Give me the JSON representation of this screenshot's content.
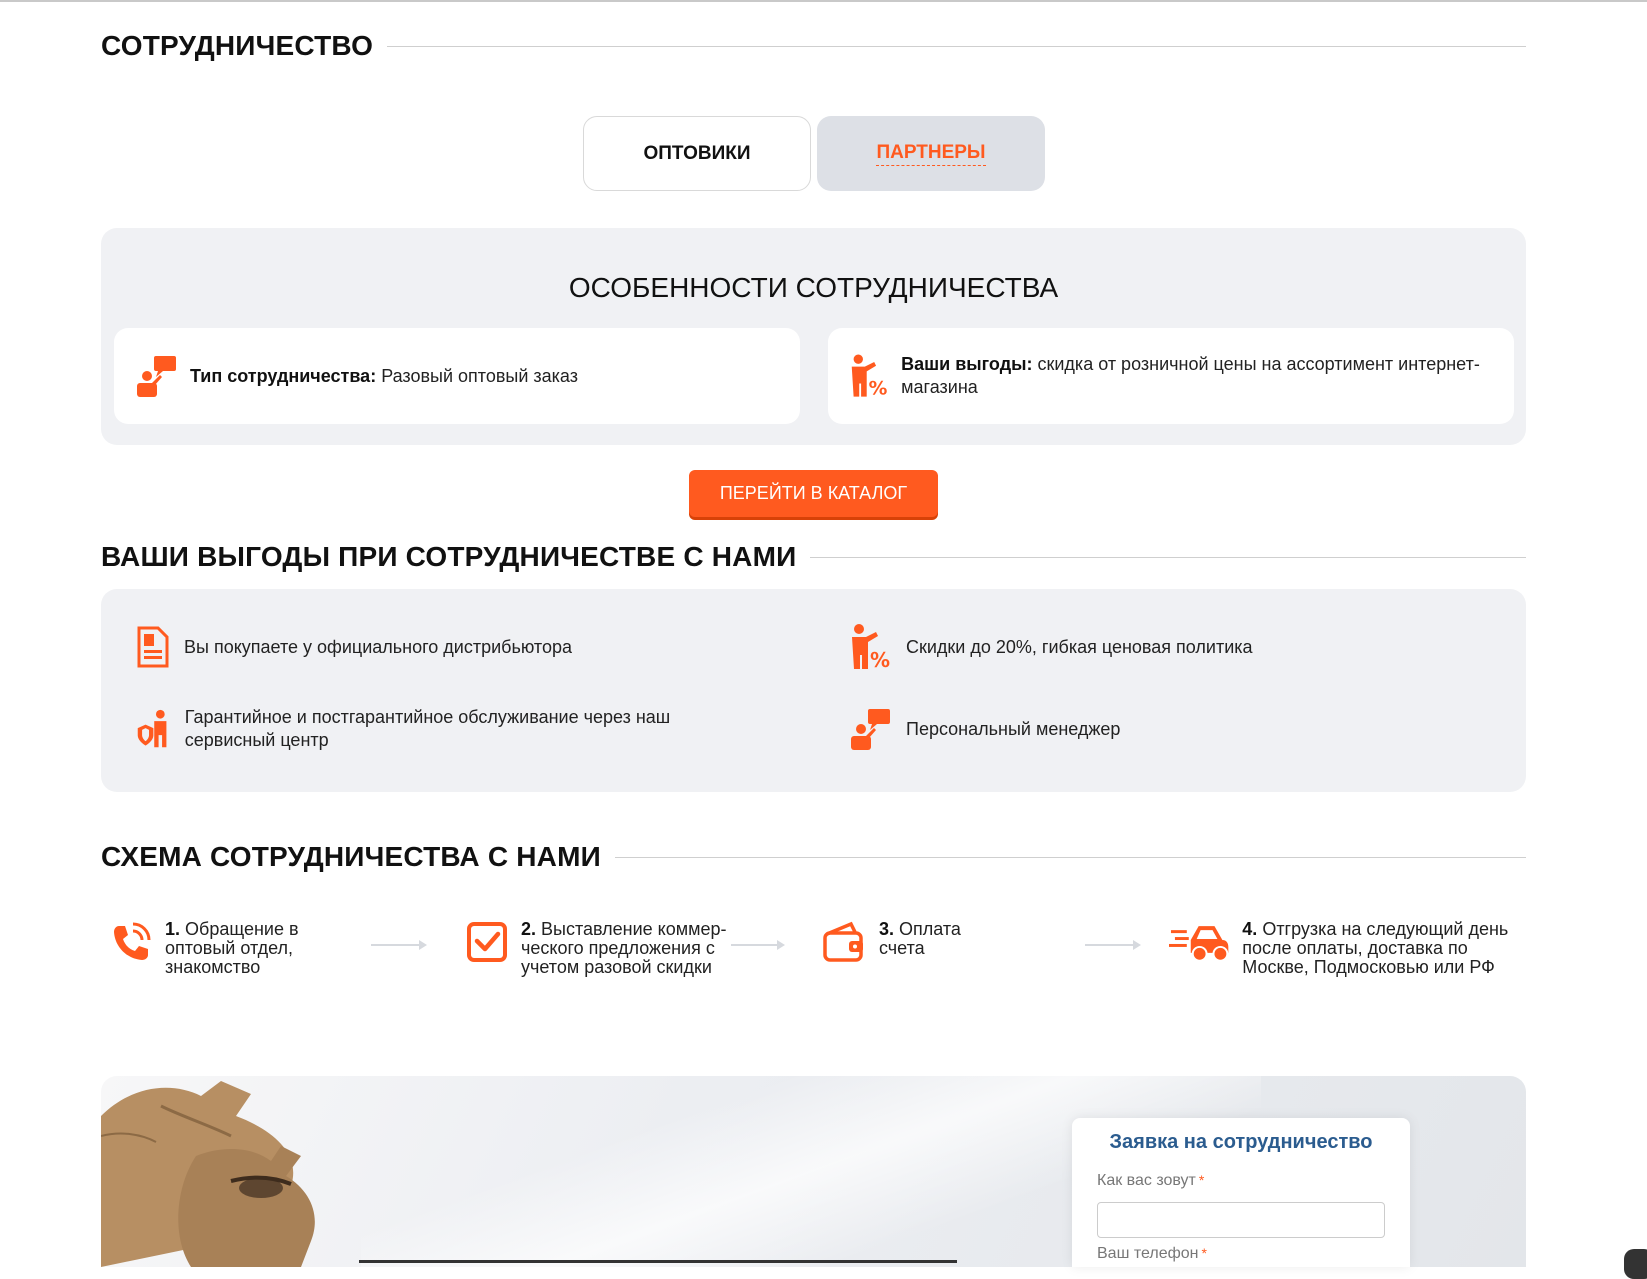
{
  "section_cooperation": {
    "title": "СОТРУДНИЧЕСТВО"
  },
  "tabs": [
    {
      "label": "ОПТОВИКИ"
    },
    {
      "label": "ПАРТНЕРЫ"
    }
  ],
  "features": {
    "title": "ОСОБЕННОСТИ СОТРУДНИЧЕСТВА",
    "cards": [
      {
        "label": "Тип сотрудничества:",
        "value": " Разовый оптовый заказ",
        "icon": "manager-chat-icon"
      },
      {
        "label": "Ваши выгоды:",
        "value": " скидка от розничной цены на ассортимент интернет-магазина",
        "icon": "discount-person-icon"
      }
    ]
  },
  "catalog_button": {
    "label": "ПЕРЕЙТИ В КАТАЛОГ"
  },
  "benefits": {
    "title": "ВАШИ ВЫГОДЫ ПРИ СОТРУДНИЧЕСТВЕ С НАМИ",
    "items": [
      {
        "text": "Вы покупаете у официального дистрибьютора",
        "icon": "document-icon"
      },
      {
        "text": "Скидки до 20%, гибкая ценовая политика",
        "icon": "discount-person-icon"
      },
      {
        "text": "Гарантийное и постгарантийное обслуживание через наш сервисный центр",
        "icon": "shield-person-icon"
      },
      {
        "text": "Персональный менеджер",
        "icon": "manager-chat-icon"
      }
    ]
  },
  "scheme": {
    "title": "СХЕМА СОТРУДНИЧЕСТВА С НАМИ",
    "steps": [
      {
        "num": "1.",
        "text": " Обращение в оптовый отдел, знакомство",
        "icon": "phone-icon"
      },
      {
        "num": "2.",
        "text": " Выставление коммер-ческого предложения с учетом разовой скидки",
        "icon": "checkbox-icon"
      },
      {
        "num": "3.",
        "text": " Оплата счета",
        "icon": "wallet-icon"
      },
      {
        "num": "4.",
        "text": " Отгрузка на следующий день после оплаты, доставка по Москве, Подмосковью или РФ",
        "icon": "delivery-car-icon"
      }
    ]
  },
  "form": {
    "title": "Заявка на сотрудничество",
    "name_label": "Как вас зовут",
    "name_value": "",
    "phone_label": "Ваш телефон",
    "required_mark": "*"
  },
  "colors": {
    "accent": "#ff5a1f",
    "panel": "#f0f1f4",
    "form_title": "#2b5c8f"
  }
}
